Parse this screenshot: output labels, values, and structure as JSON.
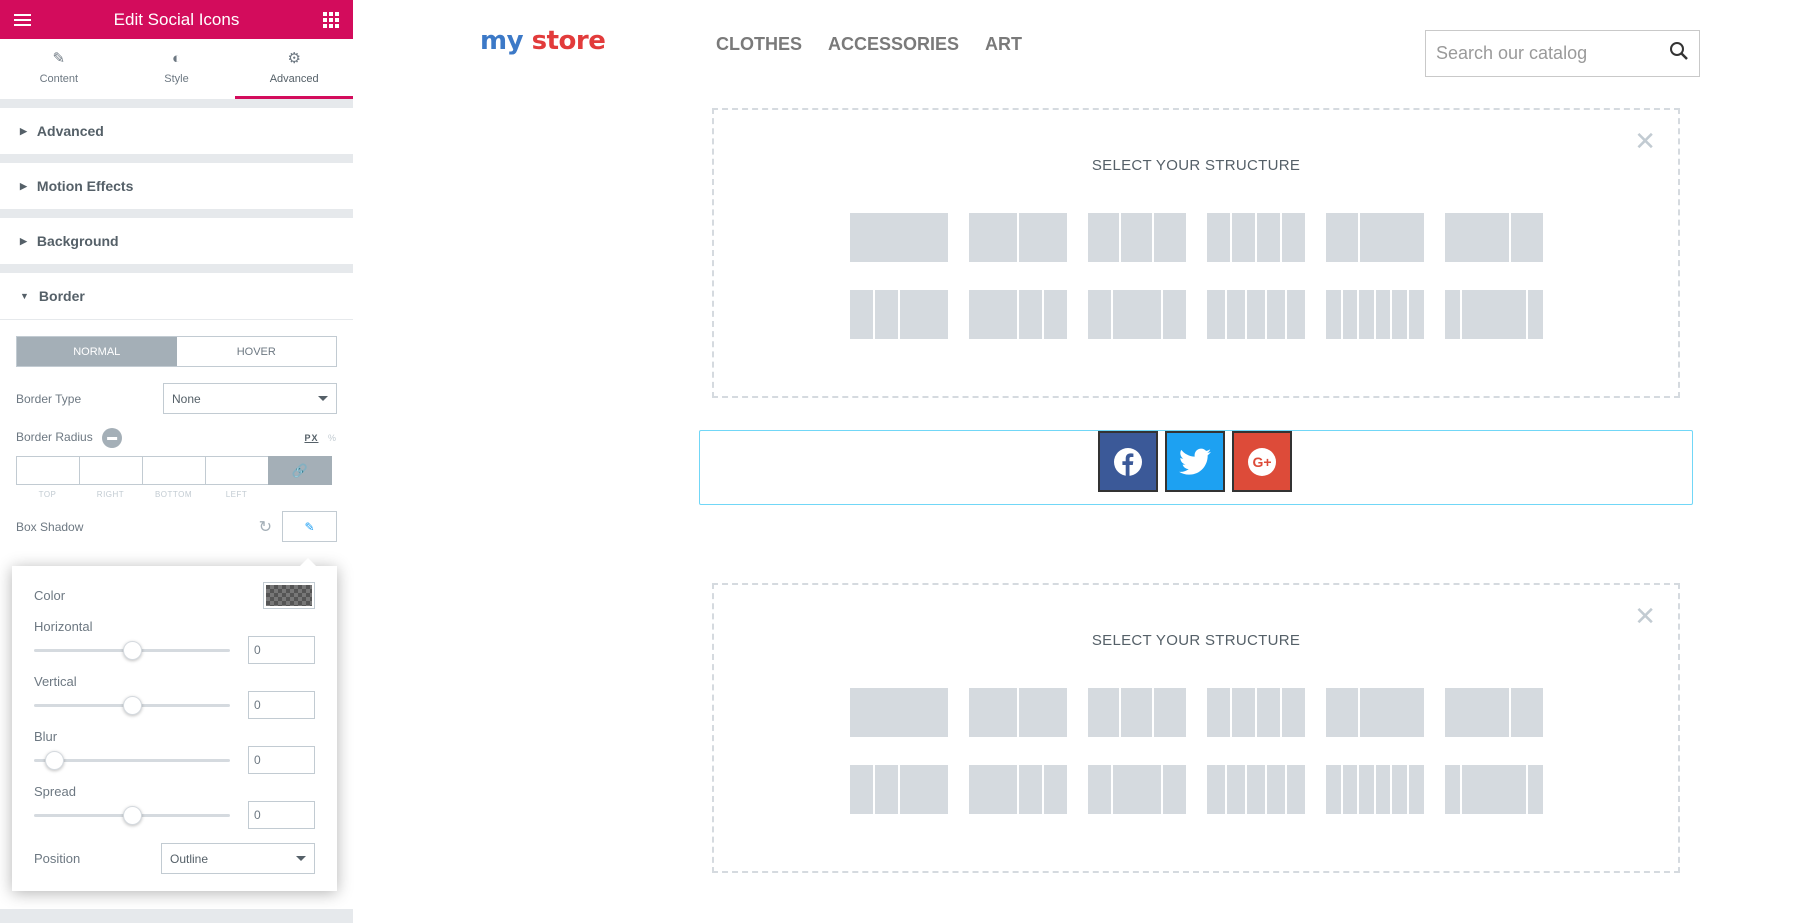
{
  "panel": {
    "title": "Edit Social Icons",
    "tabs": [
      {
        "label": "Content",
        "icon": "pencil-icon"
      },
      {
        "label": "Style",
        "icon": "half-circle-icon"
      },
      {
        "label": "Advanced",
        "icon": "gear-icon",
        "active": true
      }
    ],
    "sections": [
      "Advanced",
      "Motion Effects",
      "Background",
      "Border"
    ],
    "border": {
      "state_tabs": [
        "NORMAL",
        "HOVER"
      ],
      "border_type_label": "Border Type",
      "border_type_value": "None",
      "border_radius_label": "Border Radius",
      "units": [
        "PX",
        "%"
      ],
      "dim_labels": [
        "TOP",
        "RIGHT",
        "BOTTOM",
        "LEFT"
      ],
      "box_shadow_label": "Box Shadow"
    },
    "box_shadow": {
      "color_label": "Color",
      "horizontal_label": "Horizontal",
      "horizontal_value": "0",
      "horizontal_fraction": 0.5,
      "vertical_label": "Vertical",
      "vertical_value": "0",
      "vertical_fraction": 0.5,
      "blur_label": "Blur",
      "blur_value": "0",
      "blur_fraction": 0.1,
      "spread_label": "Spread",
      "spread_value": "0",
      "spread_fraction": 0.5,
      "position_label": "Position",
      "position_value": "Outline"
    }
  },
  "preview": {
    "logo_part1": "my",
    "logo_part2": " store",
    "nav": [
      "CLOTHES",
      "ACCESSORIES",
      "ART"
    ],
    "search_placeholder": "Search our catalog",
    "structure_title": "SELECT YOUR STRUCTURE",
    "social": [
      "facebook-icon",
      "twitter-icon",
      "google-plus-icon"
    ]
  },
  "colors": {
    "accent": "#d30c5c",
    "facebook": "#3b5998",
    "twitter": "#1da1f2",
    "google_plus": "#dd4b39"
  }
}
